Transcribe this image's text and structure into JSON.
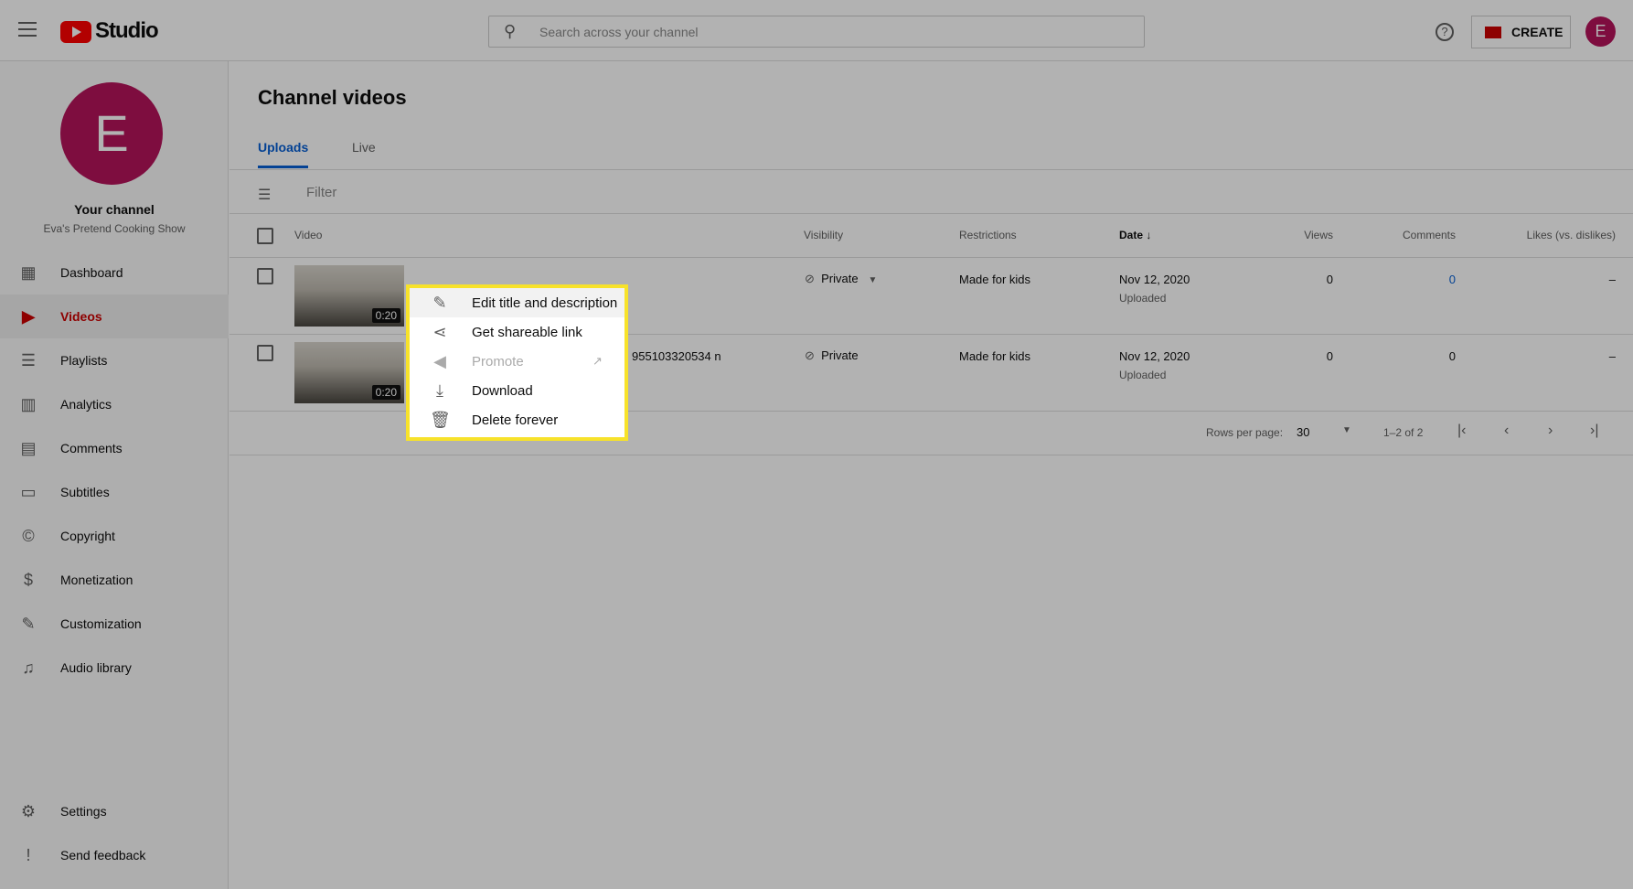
{
  "header": {
    "logo_text": "Studio",
    "search_placeholder": "Search across your channel",
    "create_label": "CREATE",
    "avatar_letter": "E"
  },
  "sidebar": {
    "avatar_letter": "E",
    "channel_label": "Your channel",
    "channel_name": "Eva's Pretend Cooking Show",
    "items": [
      {
        "label": "Dashboard",
        "icon": "dashboard-icon"
      },
      {
        "label": "Videos",
        "icon": "videos-icon",
        "active": true
      },
      {
        "label": "Playlists",
        "icon": "playlists-icon"
      },
      {
        "label": "Analytics",
        "icon": "analytics-icon"
      },
      {
        "label": "Comments",
        "icon": "comments-icon"
      },
      {
        "label": "Subtitles",
        "icon": "subtitles-icon"
      },
      {
        "label": "Copyright",
        "icon": "copyright-icon"
      },
      {
        "label": "Monetization",
        "icon": "dollar-icon"
      },
      {
        "label": "Customization",
        "icon": "magic-wand-icon"
      },
      {
        "label": "Audio library",
        "icon": "audio-library-icon"
      }
    ],
    "bottom": [
      {
        "label": "Settings",
        "icon": "gear-icon"
      },
      {
        "label": "Send feedback",
        "icon": "feedback-icon"
      }
    ]
  },
  "main": {
    "title": "Channel videos",
    "tabs": [
      {
        "label": "Uploads",
        "active": true
      },
      {
        "label": "Live"
      }
    ],
    "filter_placeholder": "Filter",
    "columns": {
      "video": "Video",
      "visibility": "Visibility",
      "restrictions": "Restrictions",
      "date": "Date",
      "views": "Views",
      "comments": "Comments",
      "likes": "Likes (vs. dislikes)"
    },
    "rows": [
      {
        "duration": "0:20",
        "title": "",
        "visibility": "Private",
        "restrictions": "Made for kids",
        "date": "Nov 12, 2020",
        "status": "Uploaded",
        "views": "0",
        "comments": "0",
        "likes": "–"
      },
      {
        "duration": "0:20",
        "title": "955103320534 n",
        "visibility": "Private",
        "restrictions": "Made for kids",
        "date": "Nov 12, 2020",
        "status": "Uploaded",
        "views": "0",
        "comments": "0",
        "likes": "–"
      }
    ],
    "pagination": {
      "rows_label": "Rows per page:",
      "rows_value": "30",
      "range": "1–2 of 2"
    }
  },
  "menu": {
    "items": [
      {
        "label": "Edit title and description",
        "icon": "pencil-icon"
      },
      {
        "label": "Get shareable link",
        "icon": "share-icon"
      },
      {
        "label": "Promote",
        "icon": "megaphone-icon",
        "disabled": true
      },
      {
        "label": "Download",
        "icon": "download-icon"
      },
      {
        "label": "Delete forever",
        "icon": "trash-icon"
      }
    ]
  },
  "colors": {
    "accent": "#c00",
    "link": "#065fd4",
    "highlight": "#f7e22a"
  }
}
